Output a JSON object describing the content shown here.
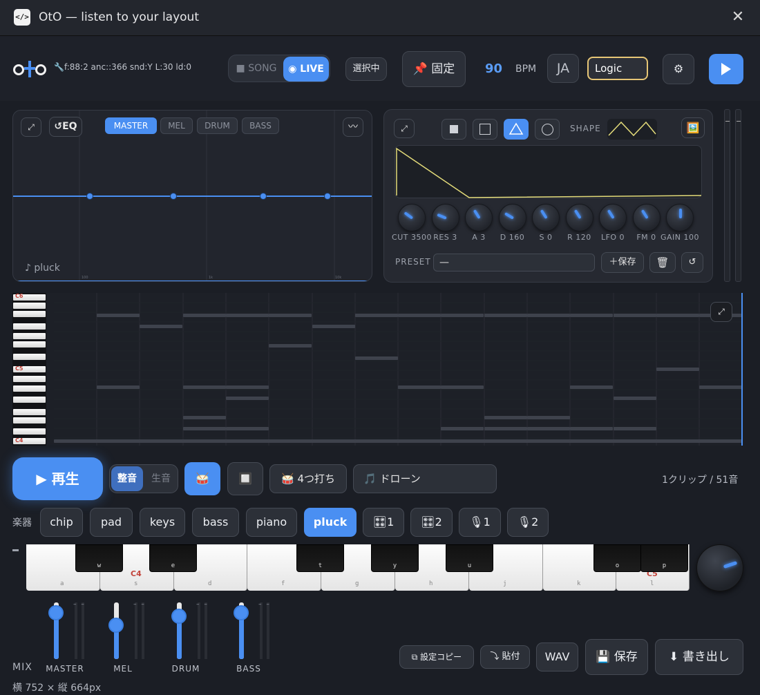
{
  "window": {
    "title": "OtO — listen to your layout",
    "icon": "</>"
  },
  "toolbar": {
    "logo": "oto",
    "status": "🔧f:88:2 anc::366 snd:Y L:30 ld:0",
    "mode_song": "SONG",
    "mode_live": "LIVE",
    "selecting": "選択中",
    "pin": "📌 固定",
    "bpm_value": "90",
    "bpm_label": "BPM",
    "lang": "JA",
    "daw_select": "Logic",
    "gear": "⚙"
  },
  "eq": {
    "expand": "⤢",
    "reset": "↺EQ",
    "tabs": [
      {
        "label": "MASTER",
        "active": true
      },
      {
        "label": "MEL",
        "active": false
      },
      {
        "label": "DRUM",
        "active": false
      },
      {
        "label": "BASS",
        "active": false
      }
    ],
    "wave_btn": "〰",
    "instrument_name": "♪ pluck",
    "ticks": [
      "100",
      "1k",
      "10k"
    ]
  },
  "synth": {
    "expand": "⤢",
    "shape_label": "SHAPE",
    "shape_selected": "triangle",
    "image_btn": "🖼️",
    "knobs": [
      {
        "label": "CUT 3500",
        "level": 0.3
      },
      {
        "label": "RES 3",
        "level": 0.25
      },
      {
        "label": "A 3",
        "level": 0.38
      },
      {
        "label": "D 160",
        "level": 0.28
      },
      {
        "label": "S 0",
        "level": 0.38
      },
      {
        "label": "R 120",
        "level": 0.38
      },
      {
        "label": "LFO 0",
        "level": 0.38
      },
      {
        "label": "FM 0",
        "level": 0.38
      },
      {
        "label": "GAIN 100",
        "level": 0.5
      }
    ],
    "preset_label": "PRESET",
    "preset_value": "—",
    "save_btn": "＋保存",
    "delete_icon": "🗑",
    "reset_btn": "↺"
  },
  "roll": {
    "key_labels": [
      "C6",
      "C5",
      "C4"
    ],
    "expand": "⤢"
  },
  "transport": {
    "play": "▶ 再生",
    "tone_on": "整音",
    "tone_off": "生音",
    "drum_icon": "🥁",
    "snow_icon": "🔲",
    "four_on_floor": "🥁 4つ打ち",
    "drone": "🎵 ドローン",
    "clip_count": "1クリップ / 51音"
  },
  "instruments": {
    "label": "楽器",
    "items": [
      {
        "label": "chip",
        "active": false
      },
      {
        "label": "pad",
        "active": false
      },
      {
        "label": "keys",
        "active": false
      },
      {
        "label": "bass",
        "active": false
      },
      {
        "label": "piano",
        "active": false
      },
      {
        "label": "pluck",
        "active": true
      },
      {
        "label": "🎛1",
        "active": false
      },
      {
        "label": "🎛2",
        "active": false
      },
      {
        "label": "🎙1",
        "active": false
      },
      {
        "label": "🎙2",
        "active": false
      }
    ]
  },
  "keyboard": {
    "white_hints": [
      "a",
      "s",
      "d",
      "f",
      "g",
      "h",
      "j",
      "k",
      "l"
    ],
    "black_hints": [
      "w",
      "e",
      "t",
      "y",
      "u",
      "o",
      "p"
    ],
    "note_c4": "C4",
    "note_c5": "C5"
  },
  "mixer": {
    "label": "MIX",
    "channels": [
      {
        "label": "MASTER",
        "level": 0.82
      },
      {
        "label": "MEL",
        "level": 0.6
      },
      {
        "label": "DRUM",
        "level": 0.75
      },
      {
        "label": "BASS",
        "level": 0.82
      }
    ],
    "meter_dash": "– –"
  },
  "footer": {
    "size": "横 752 × 縦 664px",
    "copy_settings": "⧉ 設定コピー",
    "paste": "⤵ 貼付",
    "wav": "WAV",
    "save": "💾 保存",
    "export": "⬇ 書き出し"
  },
  "colors": {
    "accent": "#4a8ff2",
    "highlight": "#e7c676",
    "note_red": "#c2443b"
  }
}
